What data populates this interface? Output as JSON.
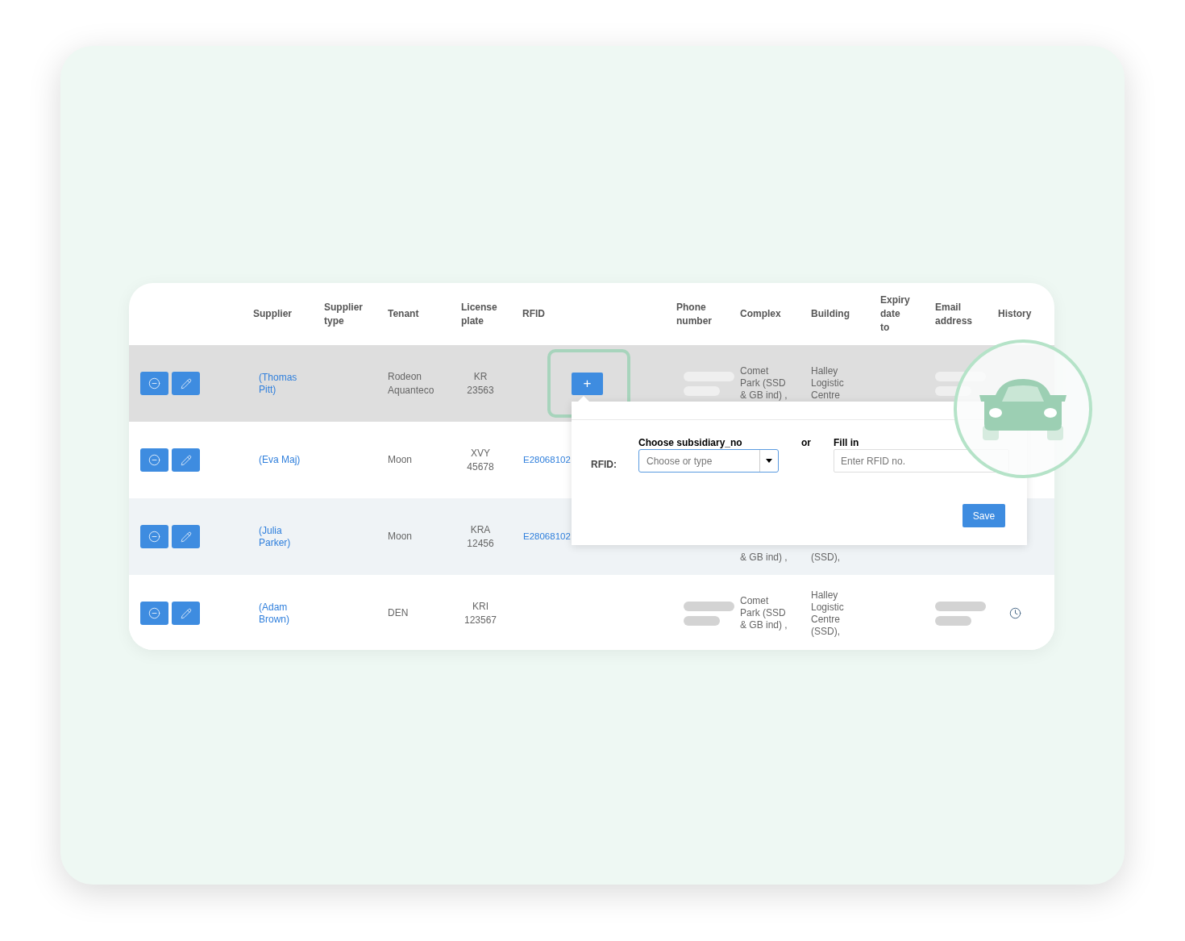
{
  "table": {
    "columns": [
      "Supplier",
      "Supplier type",
      "Tenant",
      "License plate",
      "RFID",
      "Phone number",
      "Complex",
      "Building",
      "Expiry date to",
      "Email address",
      "History"
    ],
    "rows": [
      {
        "selected": true,
        "covered": false,
        "supplier": "(Thomas Pitt)",
        "tenant": "Rodeon Aquanteco",
        "license_plate": "KR 23563",
        "rfid_button": "+",
        "phone_redacted": true,
        "complex": "Comet Park (SSD & GB ind) ,",
        "building": "Halley Logistic Centre",
        "email_redacted": true,
        "history": false
      },
      {
        "selected": false,
        "supplier": "(Eva Maj)",
        "tenant": "Moon",
        "license_plate": "XVY 45678",
        "rfid": "E28068102",
        "phone_redacted": false,
        "email_redacted": false,
        "history": false
      },
      {
        "selected": false,
        "covered": true,
        "supplier": "(Julia Parker)",
        "tenant": "Moon",
        "license_plate": "KRA 12456",
        "rfid": "E28068102",
        "phone_redacted": false,
        "complex": "& GB ind) ,",
        "building": "(SSD),",
        "email_redacted": false,
        "history": false
      },
      {
        "selected": false,
        "covered": false,
        "supplier": "(Adam Brown)",
        "tenant": "DEN",
        "license_plate": "KRI 123567",
        "phone_redacted": true,
        "complex": "Comet Park (SSD & GB ind) ,",
        "building": "Halley Logistic Centre (SSD),",
        "email_redacted": true,
        "history": true
      }
    ]
  },
  "rfid_popover": {
    "label": "RFID:",
    "select": {
      "label": "Choose subsidiary_no",
      "placeholder": "Choose or type"
    },
    "separator": "or",
    "input": {
      "label": "Fill in",
      "placeholder": "Enter RFID no."
    },
    "save_button": "Save"
  }
}
